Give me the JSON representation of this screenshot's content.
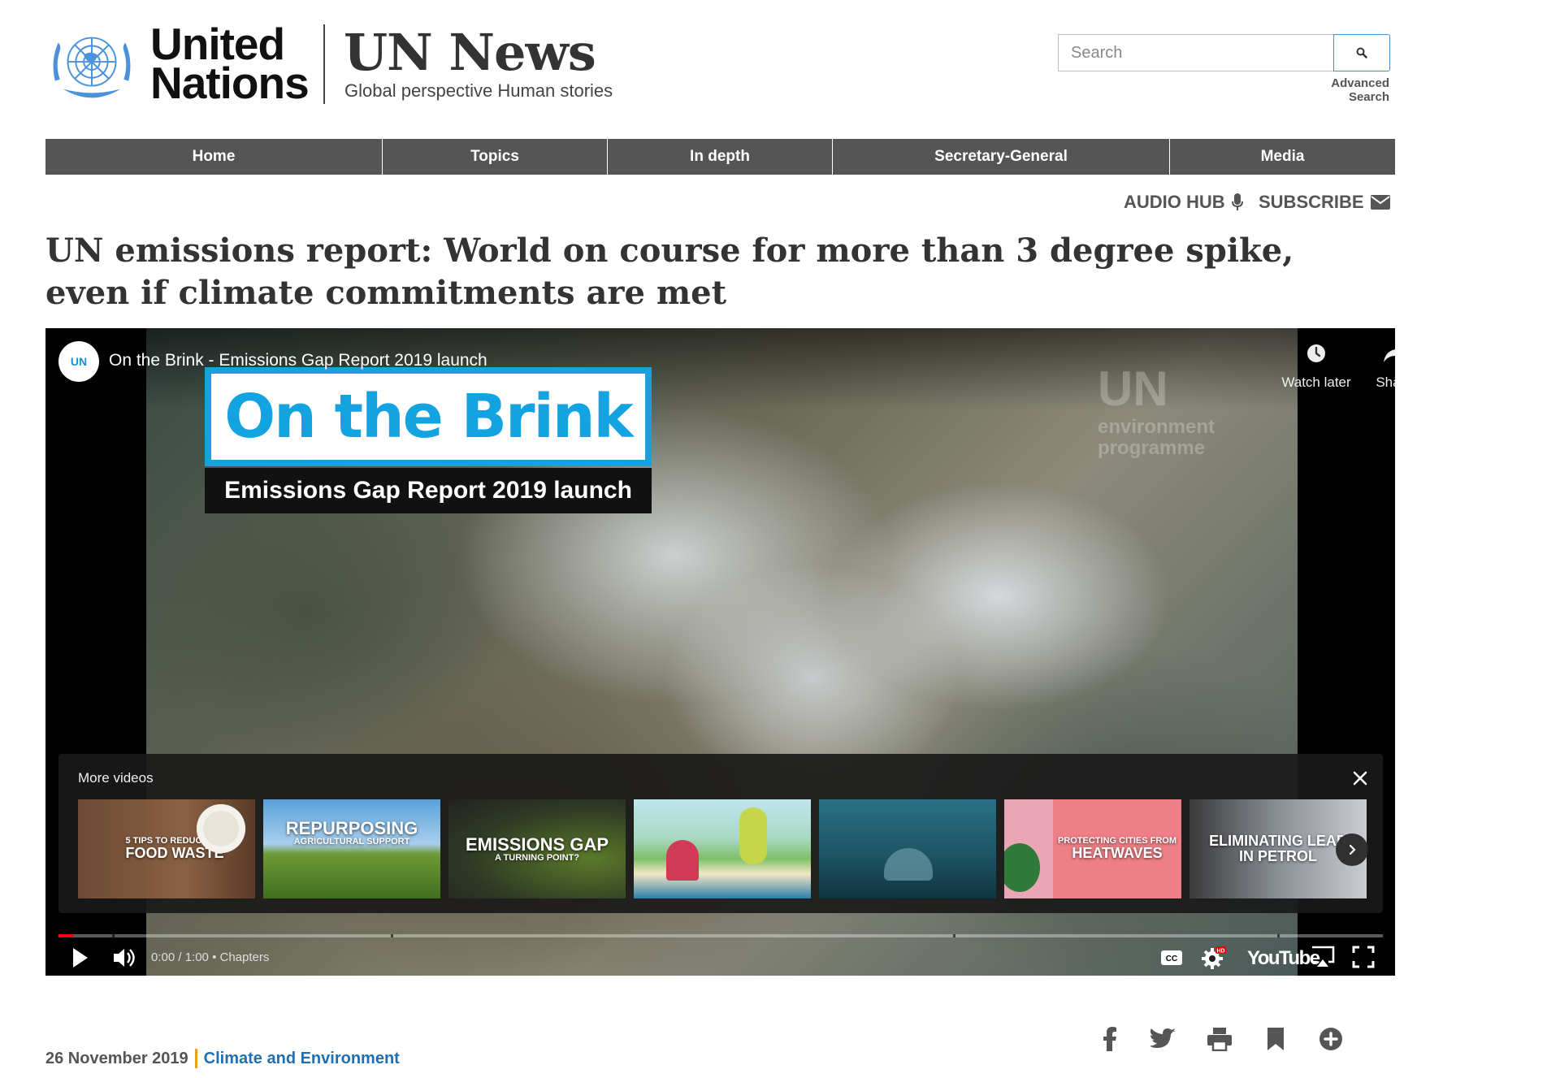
{
  "brand": {
    "org_line1": "United",
    "org_line2": "Nations",
    "site_title": "UN News",
    "tagline": "Global perspective Human stories"
  },
  "search": {
    "placeholder": "Search",
    "value": "",
    "advanced_label": "Advanced Search",
    "icon": "search-icon"
  },
  "nav": {
    "items": [
      {
        "label": "Home"
      },
      {
        "label": "Topics"
      },
      {
        "label": "In depth"
      },
      {
        "label": "Secretary-General"
      },
      {
        "label": "Media"
      }
    ]
  },
  "utility": {
    "audio_hub": "AUDIO HUB",
    "audio_icon": "microphone-icon",
    "subscribe": "SUBSCRIBE",
    "subscribe_icon": "envelope-icon"
  },
  "article": {
    "headline": "UN emissions report: World on course for more than 3 degree spike, even if climate commitments are met",
    "date": "26 November 2019",
    "category": "Climate and Environment"
  },
  "video": {
    "channel_badge": "UN",
    "title": "On the Brink - Emissions Gap Report 2019 launch",
    "watch_later": "Watch later",
    "share": "Share",
    "overlay_title": "On the Brink",
    "overlay_subtitle": "Emissions Gap Report 2019 launch",
    "more_videos_label": "More videos",
    "thumbnails": [
      {
        "line1": "FOOD WASTE",
        "line2": "5 TIPS TO REDUCE"
      },
      {
        "line1": "REPURPOSING",
        "line2": "AGRICULTURAL SUPPORT"
      },
      {
        "line1": "EMISSIONS GAP",
        "line2": "A TURNING POINT?"
      },
      {
        "line1": "",
        "line2": ""
      },
      {
        "line1": "",
        "line2": ""
      },
      {
        "line1": "HEATWAVES",
        "line2": "PROTECTING CITIES FROM"
      },
      {
        "line1": "ELIMINATING LEAD IN PETROL",
        "line2": ""
      }
    ],
    "time_display": "0:00 / 1:00",
    "chapters_label": "Chapters",
    "platform": "YouTube",
    "progress_fraction": 0.011
  },
  "colors": {
    "nav_bg": "#555555",
    "accent_blue": "#1f6fb2",
    "accent_orange": "#f29e1c",
    "un_blue": "#4b92db",
    "brink_blue": "#12a3e0",
    "progress_red": "#ff0000"
  }
}
